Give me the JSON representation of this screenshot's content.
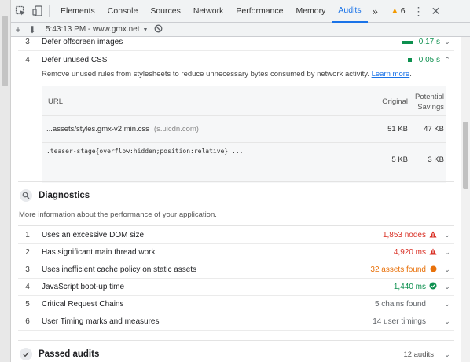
{
  "tabs": [
    "Elements",
    "Console",
    "Sources",
    "Network",
    "Performance",
    "Memory",
    "Audits"
  ],
  "active_tab": "Audits",
  "more_tabs": "»",
  "warnings_count": "6",
  "toolbar": {
    "add": "+",
    "download": "⬇",
    "report": "5:43:13 PM - www.gmx.net",
    "clear": "⃠"
  },
  "opportunities": [
    {
      "num": "3",
      "title": "Defer offscreen images",
      "value": "0.17 s",
      "indicator": "bar",
      "expanded": false
    },
    {
      "num": "4",
      "title": "Defer unused CSS",
      "value": "0.05 s",
      "indicator": "dot",
      "expanded": true
    }
  ],
  "unused_css": {
    "description": "Remove unused rules from stylesheets to reduce unnecessary bytes consumed by network activity.",
    "learn_more": "Learn more",
    "period": ".",
    "headers": {
      "url": "URL",
      "original": "Original",
      "savings_line1": "Potential",
      "savings_line2": "Savings"
    },
    "rows": [
      {
        "url": "...assets/styles.gmx-v2.min.css",
        "host": "(s.uicdn.com)",
        "original": "51 KB",
        "savings": "47 KB"
      },
      {
        "code": ".teaser-stage{overflow:hidden;position:relative} ...",
        "original": "5 KB",
        "savings": "3 KB"
      }
    ]
  },
  "diagnostics": {
    "title": "Diagnostics",
    "subtitle": "More information about the performance of your application.",
    "items": [
      {
        "num": "1",
        "title": "Uses an excessive DOM size",
        "value": "1,853 nodes",
        "status": "fail",
        "color": "#d93025"
      },
      {
        "num": "2",
        "title": "Has significant main thread work",
        "value": "4,920 ms",
        "status": "fail",
        "color": "#d93025"
      },
      {
        "num": "3",
        "title": "Uses inefficient cache policy on static assets",
        "value": "32 assets found",
        "status": "average",
        "color": "#e8710a"
      },
      {
        "num": "4",
        "title": "JavaScript boot-up time",
        "value": "1,440 ms",
        "status": "pass",
        "color": "#0d904f"
      },
      {
        "num": "5",
        "title": "Critical Request Chains",
        "value": "5 chains found",
        "status": "info",
        "color": "#5f6368"
      },
      {
        "num": "6",
        "title": "User Timing marks and measures",
        "value": "14 user timings",
        "status": "info",
        "color": "#5f6368"
      }
    ]
  },
  "passed_audits": {
    "title": "Passed audits",
    "count": "12 audits"
  }
}
